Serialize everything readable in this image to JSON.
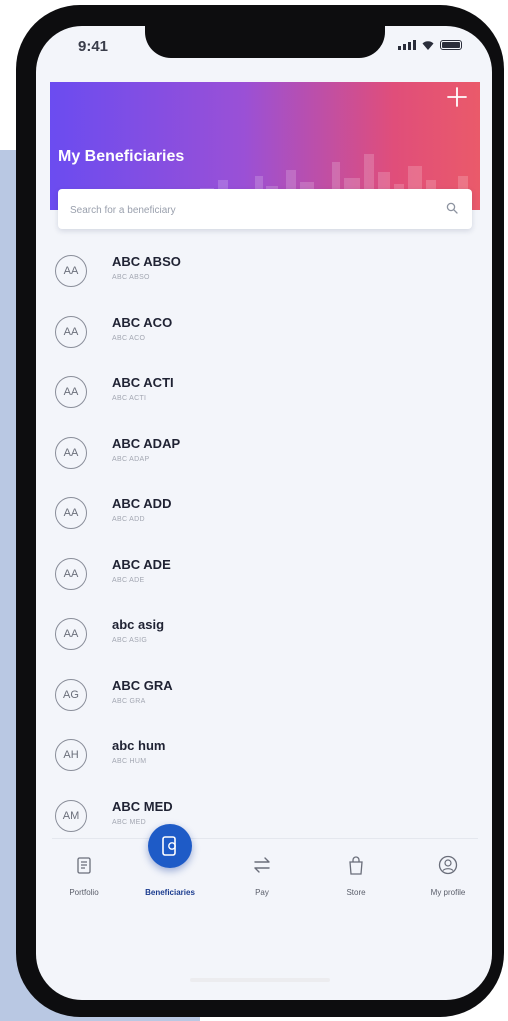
{
  "status": {
    "time": "9:41"
  },
  "header": {
    "title": "My Beneficiaries",
    "add_icon": "plus-icon"
  },
  "search": {
    "placeholder": "Search for a beneficiary",
    "value": "",
    "icon": "search-icon"
  },
  "beneficiaries": [
    {
      "initials": "AA",
      "name": "ABC ABSO",
      "sub": "ABC ABSO"
    },
    {
      "initials": "AA",
      "name": "ABC ACO",
      "sub": "ABC ACO"
    },
    {
      "initials": "AA",
      "name": "ABC ACTI",
      "sub": "ABC ACTI"
    },
    {
      "initials": "AA",
      "name": "ABC ADAP",
      "sub": "ABC ADAP"
    },
    {
      "initials": "AA",
      "name": "ABC ADD",
      "sub": "ABC ADD"
    },
    {
      "initials": "AA",
      "name": "ABC ADE",
      "sub": "ABC ADE"
    },
    {
      "initials": "AA",
      "name": "abc asig",
      "sub": "ABC ASIG"
    },
    {
      "initials": "AG",
      "name": "ABC GRA",
      "sub": "ABC GRA"
    },
    {
      "initials": "AH",
      "name": "abc hum",
      "sub": "ABC HUM"
    },
    {
      "initials": "AM",
      "name": "ABC MED",
      "sub": "ABC MED"
    }
  ],
  "tabs": [
    {
      "label": "Portfolio",
      "icon": "portfolio-icon",
      "active": false
    },
    {
      "label": "Beneficiaries",
      "icon": "beneficiaries-icon",
      "active": true
    },
    {
      "label": "Pay",
      "icon": "transfer-arrows-icon",
      "active": false
    },
    {
      "label": "Store",
      "icon": "shopping-bag-icon",
      "active": false
    },
    {
      "label": "My profile",
      "icon": "profile-icon",
      "active": false
    }
  ],
  "colors": {
    "header_gradient": [
      "#6b4cf0",
      "#e04e7a"
    ],
    "accent": "#1e5bc7",
    "background_panel": "#b9c8e3"
  }
}
